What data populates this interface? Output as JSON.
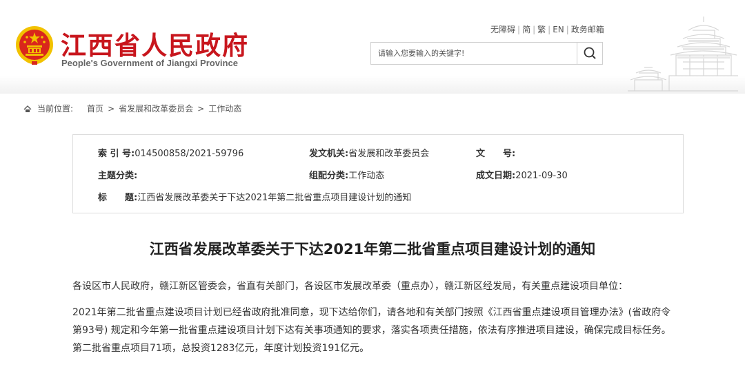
{
  "header": {
    "title": "江西省人民政府",
    "subtitle": "People's Government of Jiangxi Province",
    "links": [
      "无障碍",
      "简",
      "繁",
      "EN",
      "政务邮箱"
    ],
    "search_placeholder": "请输入您要输入的关键字!"
  },
  "breadcrumb": {
    "label": "当前位置:",
    "items": [
      "首页",
      "省发展和改革委员会",
      "工作动态"
    ],
    "separator": ">"
  },
  "info": {
    "index_key": "索 引 号:",
    "index_value": "014500858/2021-59796",
    "issuer_key": "发文机关:",
    "issuer_value": "省发展和改革委员会",
    "docno_key": "文　　号:",
    "docno_value": "",
    "subject_key": "主题分类:",
    "subject_value": "",
    "category_key": "组配分类:",
    "category_value": "工作动态",
    "date_key": "成文日期:",
    "date_value": "2021-09-30",
    "title_key": "标　　题:",
    "title_value": "江西省发展改革委关于下达2021年第二批省重点项目建设计划的通知"
  },
  "article": {
    "title": "江西省发展改革委关于下达2021年第二批省重点项目建设计划的通知",
    "salutation": "各设区市人民政府，赣江新区管委会，省直有关部门，各设区市发展改革委（重点办），赣江新区经发局，有关重点建设项目单位：",
    "body": "2021年第二批省重点建设项目计划已经省政府批准同意，现下达给你们，请各地和有关部门按照《江西省重点建设项目管理办法》(省政府令第93号) 规定和今年第一批省重点建设项目计划下达有关事项通知的要求，落实各项责任措施，依法有序推进项目建设，确保完成目标任务。第二批省重点项目71项，总投资1283亿元，年度计划投资191亿元。"
  },
  "colors": {
    "brand_red": "#c8161d",
    "emblem_gold": "#f2c200"
  }
}
